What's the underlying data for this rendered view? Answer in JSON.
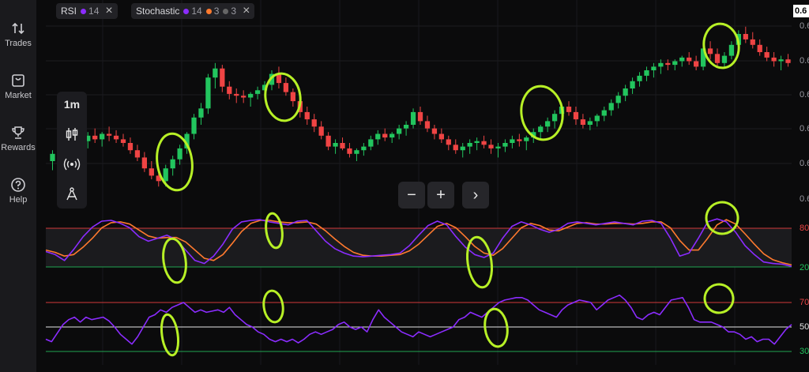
{
  "sidebar": {
    "items": [
      {
        "label": "Trades",
        "icon": "arrows-updown-icon"
      },
      {
        "label": "Market",
        "icon": "shopping-bag-icon"
      },
      {
        "label": "Rewards",
        "icon": "trophy-icon"
      },
      {
        "label": "Help",
        "icon": "question-icon"
      }
    ]
  },
  "indicators": [
    {
      "name": "RSI",
      "period": "14",
      "color": "#8b2cff"
    },
    {
      "name": "Stochastic",
      "k": "14",
      "d": "3",
      "smooth": "3",
      "k_color": "#8b2cff",
      "d_color": "#ff7a2e"
    }
  ],
  "toolbar": {
    "timeframe": "1m",
    "tools": [
      "candles-icon",
      "broadcast-icon",
      "compass-icon"
    ]
  },
  "price_tag": "0.6",
  "zoom": {
    "minus": "−",
    "plus": "+",
    "next": "›"
  },
  "stoch_levels": {
    "high": "80",
    "low": "20"
  },
  "rsi_levels": {
    "high": "70",
    "mid": "50",
    "low": "30"
  },
  "colors": {
    "bull": "#22c55e",
    "bear": "#ef4444",
    "annotation": "#b7f026",
    "line_purple": "#8b2cff",
    "line_orange": "#ff7a2e"
  },
  "price_axis_labels": [
    "0.6",
    "0.6",
    "0.6",
    "0.6",
    "0.6",
    "0.6",
    "0.6"
  ],
  "chart_data": {
    "type": "candlestick",
    "candles": [
      [
        60,
        66,
        55,
        64
      ],
      [
        64,
        68,
        60,
        59
      ],
      [
        59,
        64,
        55,
        62
      ],
      [
        62,
        70,
        58,
        68
      ],
      [
        68,
        74,
        64,
        71
      ],
      [
        71,
        76,
        67,
        74
      ],
      [
        74,
        78,
        70,
        72
      ],
      [
        72,
        76,
        68,
        75
      ],
      [
        75,
        79,
        71,
        74
      ],
      [
        74,
        77,
        70,
        72
      ],
      [
        72,
        75,
        68,
        70
      ],
      [
        70,
        73,
        64,
        66
      ],
      [
        66,
        69,
        60,
        62
      ],
      [
        62,
        65,
        54,
        56
      ],
      [
        56,
        60,
        50,
        52
      ],
      [
        52,
        57,
        46,
        49
      ],
      [
        49,
        58,
        46,
        56
      ],
      [
        56,
        63,
        52,
        61
      ],
      [
        61,
        69,
        58,
        67
      ],
      [
        67,
        76,
        64,
        75
      ],
      [
        75,
        86,
        72,
        84
      ],
      [
        84,
        92,
        80,
        89
      ],
      [
        89,
        108,
        86,
        106
      ],
      [
        106,
        114,
        100,
        111
      ],
      [
        111,
        113,
        98,
        101
      ],
      [
        101,
        104,
        94,
        97
      ],
      [
        97,
        100,
        92,
        96
      ],
      [
        96,
        99,
        92,
        95
      ],
      [
        95,
        98,
        90,
        97
      ],
      [
        97,
        101,
        94,
        99
      ],
      [
        99,
        104,
        96,
        102
      ],
      [
        102,
        110,
        99,
        108
      ],
      [
        108,
        112,
        100,
        103
      ],
      [
        103,
        106,
        96,
        98
      ],
      [
        98,
        100,
        90,
        93
      ],
      [
        93,
        95,
        84,
        87
      ],
      [
        87,
        90,
        80,
        83
      ],
      [
        83,
        86,
        76,
        79
      ],
      [
        79,
        82,
        72,
        74
      ],
      [
        74,
        76,
        66,
        68
      ],
      [
        68,
        72,
        64,
        70
      ],
      [
        70,
        73,
        66,
        67
      ],
      [
        67,
        70,
        62,
        64
      ],
      [
        64,
        67,
        60,
        66
      ],
      [
        66,
        70,
        63,
        68
      ],
      [
        68,
        74,
        66,
        72
      ],
      [
        72,
        77,
        69,
        75
      ],
      [
        75,
        78,
        71,
        73
      ],
      [
        73,
        76,
        70,
        75
      ],
      [
        75,
        80,
        72,
        78
      ],
      [
        78,
        82,
        74,
        80
      ],
      [
        80,
        89,
        78,
        87
      ],
      [
        87,
        90,
        80,
        82
      ],
      [
        82,
        85,
        76,
        78
      ],
      [
        78,
        80,
        72,
        75
      ],
      [
        75,
        78,
        70,
        72
      ],
      [
        72,
        74,
        66,
        69
      ],
      [
        69,
        72,
        64,
        66
      ],
      [
        66,
        70,
        62,
        68
      ],
      [
        68,
        72,
        64,
        70
      ],
      [
        70,
        73,
        66,
        71
      ],
      [
        71,
        74,
        67,
        69
      ],
      [
        69,
        72,
        64,
        67
      ],
      [
        67,
        70,
        62,
        68
      ],
      [
        68,
        72,
        65,
        70
      ],
      [
        70,
        74,
        67,
        72
      ],
      [
        72,
        75,
        68,
        71
      ],
      [
        71,
        74,
        66,
        73
      ],
      [
        73,
        78,
        70,
        76
      ],
      [
        76,
        80,
        72,
        79
      ],
      [
        79,
        84,
        76,
        82
      ],
      [
        82,
        88,
        78,
        86
      ],
      [
        86,
        92,
        83,
        90
      ],
      [
        90,
        93,
        85,
        87
      ],
      [
        87,
        90,
        80,
        83
      ],
      [
        83,
        86,
        78,
        80
      ],
      [
        80,
        84,
        77,
        82
      ],
      [
        82,
        86,
        79,
        85
      ],
      [
        85,
        90,
        82,
        88
      ],
      [
        88,
        94,
        85,
        92
      ],
      [
        92,
        98,
        89,
        96
      ],
      [
        96,
        102,
        93,
        100
      ],
      [
        100,
        106,
        97,
        104
      ],
      [
        104,
        109,
        101,
        107
      ],
      [
        107,
        112,
        104,
        110
      ],
      [
        110,
        114,
        106,
        112
      ],
      [
        112,
        116,
        108,
        114
      ],
      [
        114,
        116,
        110,
        113
      ],
      [
        113,
        116,
        110,
        115
      ],
      [
        115,
        118,
        112,
        117
      ],
      [
        117,
        120,
        113,
        115
      ],
      [
        115,
        118,
        110,
        112
      ],
      [
        112,
        124,
        110,
        122
      ],
      [
        122,
        126,
        116,
        119
      ],
      [
        119,
        122,
        112,
        114
      ],
      [
        114,
        120,
        112,
        118
      ],
      [
        118,
        126,
        116,
        124
      ],
      [
        124,
        132,
        121,
        130
      ],
      [
        130,
        134,
        125,
        127
      ],
      [
        127,
        131,
        122,
        124
      ],
      [
        124,
        127,
        118,
        120
      ],
      [
        120,
        123,
        115,
        117
      ],
      [
        117,
        120,
        112,
        115
      ],
      [
        115,
        118,
        110,
        116
      ],
      [
        116,
        119,
        112,
        114
      ]
    ],
    "stochastic": {
      "k": [
        42,
        38,
        30,
        45,
        62,
        75,
        83,
        84,
        80,
        74,
        62,
        56,
        60,
        64,
        58,
        44,
        30,
        26,
        36,
        52,
        72,
        82,
        84,
        85,
        82,
        80,
        78,
        83,
        84,
        70,
        56,
        46,
        40,
        36,
        35,
        36,
        37,
        38,
        40,
        50,
        64,
        77,
        83,
        78,
        62,
        48,
        38,
        34,
        40,
        60,
        76,
        82,
        78,
        72,
        68,
        72,
        80,
        82,
        80,
        78,
        80,
        82,
        80,
        78,
        83,
        84,
        80,
        60,
        36,
        40,
        60,
        82,
        86,
        82,
        68,
        50,
        38,
        28,
        26,
        25,
        22
      ],
      "d": [
        44,
        41,
        36,
        38,
        48,
        60,
        74,
        81,
        82,
        79,
        71,
        63,
        60,
        61,
        61,
        55,
        44,
        33,
        30,
        38,
        53,
        69,
        80,
        84,
        84,
        82,
        81,
        81,
        82,
        79,
        70,
        59,
        49,
        41,
        37,
        36,
        36,
        37,
        38,
        43,
        52,
        64,
        76,
        80,
        74,
        62,
        49,
        40,
        37,
        46,
        60,
        74,
        80,
        77,
        71,
        70,
        75,
        80,
        81,
        79,
        79,
        80,
        80,
        79,
        80,
        82,
        82,
        74,
        57,
        44,
        44,
        60,
        78,
        85,
        79,
        66,
        52,
        39,
        31,
        27,
        24
      ]
    },
    "rsi": [
      40,
      38,
      45,
      52,
      56,
      58,
      54,
      58,
      56,
      57,
      58,
      55,
      50,
      44,
      40,
      36,
      42,
      50,
      58,
      60,
      64,
      62,
      66,
      68,
      70,
      66,
      62,
      64,
      62,
      63,
      64,
      62,
      66,
      60,
      56,
      52,
      50,
      46,
      44,
      40,
      38,
      40,
      38,
      40,
      37,
      40,
      44,
      46,
      44,
      46,
      48,
      52,
      54,
      50,
      48,
      50,
      46,
      56,
      64,
      58,
      54,
      50,
      46,
      44,
      42,
      46,
      44,
      42,
      44,
      46,
      48,
      50,
      56,
      58,
      62,
      60,
      58,
      62,
      66,
      70,
      72,
      73,
      74,
      74,
      72,
      68,
      64,
      62,
      60,
      58,
      64,
      68,
      70,
      72,
      71,
      70,
      64,
      68,
      72,
      74,
      76,
      72,
      66,
      58,
      56,
      60,
      62,
      60,
      66,
      72,
      73,
      74,
      66,
      56,
      54,
      54,
      54,
      52,
      50,
      46,
      46,
      44,
      40,
      42,
      38,
      40,
      40,
      36,
      42,
      48,
      52
    ],
    "stoch_levels": [
      80,
      20
    ],
    "rsi_levels": [
      70,
      50,
      30
    ]
  }
}
